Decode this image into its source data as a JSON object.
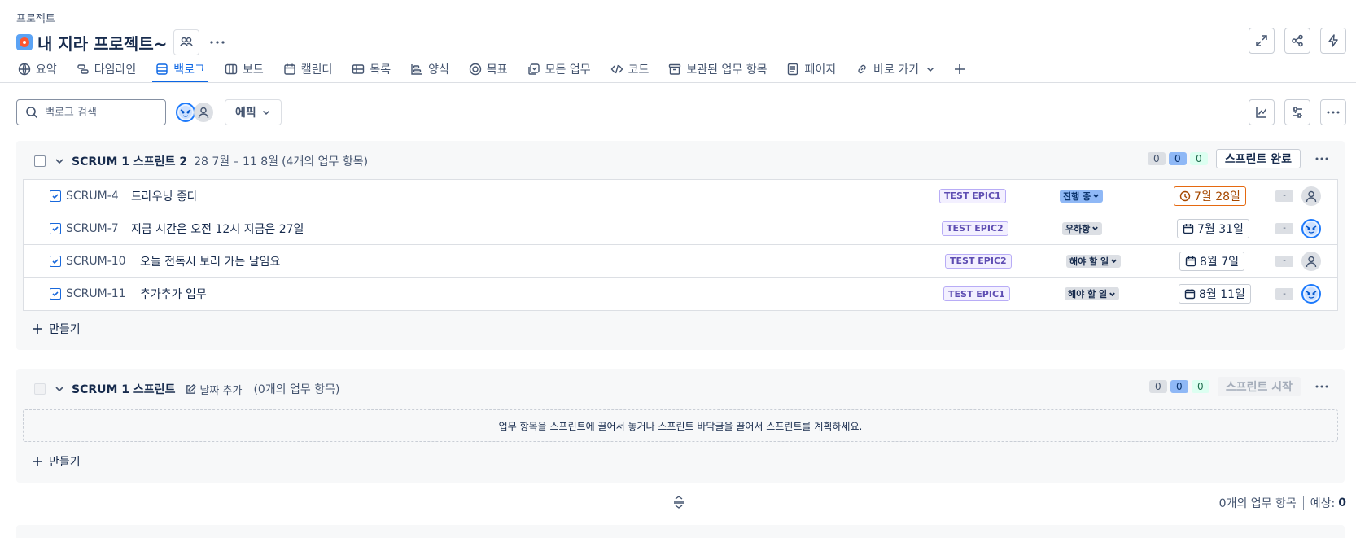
{
  "header": {
    "breadcrumb": "프로젝트",
    "title": "내 지라 프로젝트~"
  },
  "tabs": [
    {
      "label": "요약",
      "icon": "globe-icon"
    },
    {
      "label": "타임라인",
      "icon": "timeline-icon"
    },
    {
      "label": "백로그",
      "icon": "backlog-icon",
      "active": true
    },
    {
      "label": "보드",
      "icon": "board-icon"
    },
    {
      "label": "캘린더",
      "icon": "calendar-icon"
    },
    {
      "label": "목록",
      "icon": "list-icon"
    },
    {
      "label": "양식",
      "icon": "form-icon"
    },
    {
      "label": "목표",
      "icon": "target-icon"
    },
    {
      "label": "모든 업무",
      "icon": "all-work-icon"
    },
    {
      "label": "코드",
      "icon": "code-icon"
    },
    {
      "label": "보관된 업무 항목",
      "icon": "archive-icon"
    },
    {
      "label": "페이지",
      "icon": "page-icon"
    },
    {
      "label": "바로 가기",
      "icon": "link-icon"
    }
  ],
  "toolbar": {
    "search_placeholder": "백로그 검색",
    "epic_label": "에픽"
  },
  "sprint1": {
    "name": "SCRUM 1 스프린트 2",
    "dates": "28 7월 – 11 8월",
    "count": "(4개의 업무 항목)",
    "counts": {
      "todo": "0",
      "in_progress": "0",
      "done": "0"
    },
    "action": "스프린트 완료",
    "issues": [
      {
        "key": "SCRUM-4",
        "summary": "드라우닝 좋다",
        "epic": "TEST EPIC1",
        "status": "진행 중",
        "status_type": "prog",
        "due": "7월 28일",
        "overdue": true,
        "estimate": "-",
        "assignee": "person"
      },
      {
        "key": "SCRUM-7",
        "summary": "지금 시간은 오전 12시 지금은 27일",
        "epic": "TEST EPIC2",
        "status": "우하항",
        "status_type": "todo",
        "due": "7월 31일",
        "overdue": false,
        "estimate": "-",
        "assignee": "face"
      },
      {
        "key": "SCRUM-10",
        "summary": "오늘 전독시 보러 가는 날임요",
        "epic": "TEST EPIC2",
        "status": "해야 할 일",
        "status_type": "todo",
        "due": "8월 7일",
        "overdue": false,
        "estimate": "-",
        "assignee": "person"
      },
      {
        "key": "SCRUM-11",
        "summary": "추가추가 업무",
        "epic": "TEST EPIC1",
        "status": "해야 할 일",
        "status_type": "todo",
        "due": "8월 11일",
        "overdue": false,
        "estimate": "-",
        "assignee": "face"
      }
    ],
    "create_label": "만들기"
  },
  "sprint2": {
    "name": "SCRUM 1 스프린트",
    "add_date": "날짜 추가",
    "count": "(0개의 업무 항목)",
    "counts": {
      "todo": "0",
      "in_progress": "0",
      "done": "0"
    },
    "action": "스프린트 시작",
    "empty_message": "업무 항목을 스프린트에 끌어서 놓거나 스프린트 바닥글을 끌어서 스프린트를 계획하세요.",
    "create_label": "만들기"
  },
  "footer": {
    "count": "0개의 업무 항목",
    "estimate_label": "예상:",
    "estimate_value": "0"
  },
  "colors": {
    "accent": "#0c66e4",
    "epic_text": "#5e4db2",
    "overdue": "#e56910"
  }
}
